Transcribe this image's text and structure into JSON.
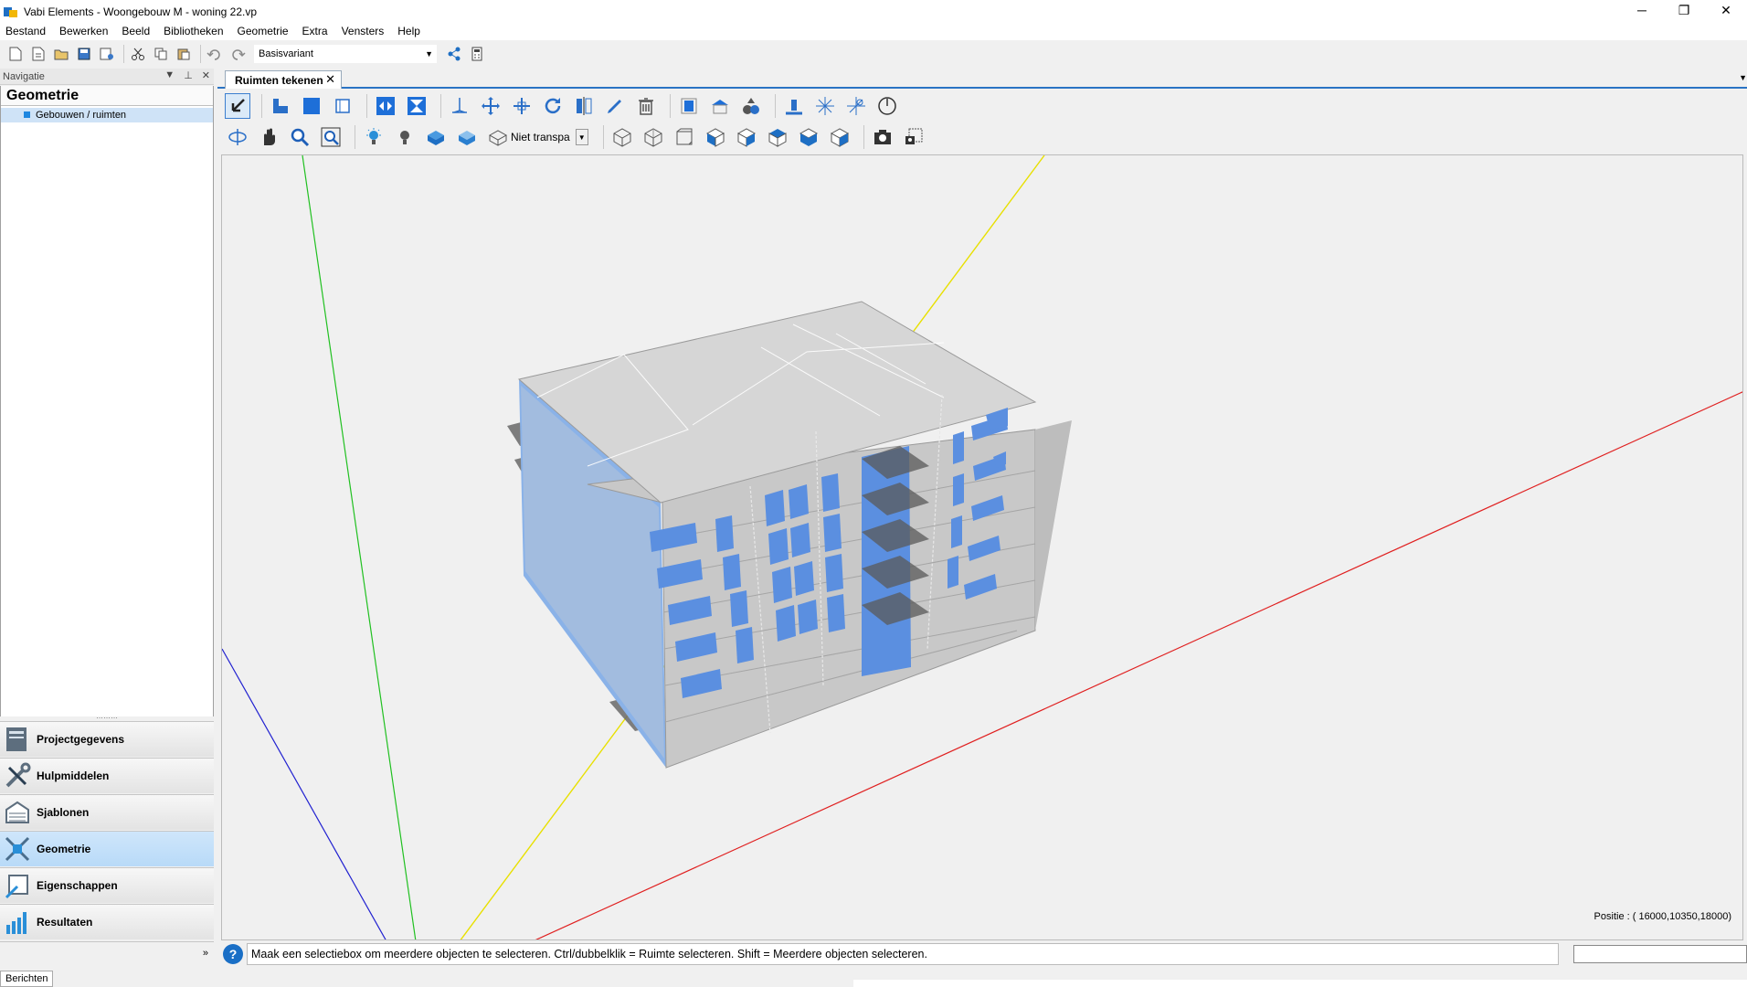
{
  "window": {
    "title": "Vabi Elements - Woongebouw M - woning 22.vp",
    "minimize": "─",
    "restore": "❐",
    "close": "✕"
  },
  "menu": [
    "Bestand",
    "Bewerken",
    "Beeld",
    "Bibliotheken",
    "Geometrie",
    "Extra",
    "Vensters",
    "Help"
  ],
  "toolbar": {
    "variant_value": "Basisvariant",
    "icons": [
      "new-file-icon",
      "new-from-template-icon",
      "open-icon",
      "save-icon",
      "save-as-icon",
      "cut-icon",
      "copy-icon",
      "paste-icon",
      "undo-icon",
      "redo-icon",
      "share-icon",
      "calculator-icon"
    ]
  },
  "navigation": {
    "header": "Navigatie",
    "section_title": "Geometrie",
    "tree_item": "Gebouwen / ruimten",
    "grip": "………",
    "buttons": [
      {
        "label": "Projectgegevens",
        "icon": "project-data-icon"
      },
      {
        "label": "Hulpmiddelen",
        "icon": "tools-icon"
      },
      {
        "label": "Sjablonen",
        "icon": "templates-icon"
      },
      {
        "label": "Geometrie",
        "icon": "geometry-icon",
        "active": true
      },
      {
        "label": "Eigenschappen",
        "icon": "properties-icon"
      },
      {
        "label": "Resultaten",
        "icon": "results-icon"
      }
    ],
    "footer_chevron": "»"
  },
  "document": {
    "tab_label": "Ruimten tekenen",
    "tab_close": "✕",
    "transparency_value": "Niet transpa",
    "position_readout": "Positie : ( 16000,10350,18000)"
  },
  "status": {
    "help": "?",
    "message": "Maak een selectiebox om meerdere objecten te selecteren. Ctrl/dubbelklik = Ruimte selecteren. Shift = Meerdere objecten selecteren."
  },
  "bottom_tab": "Berichten",
  "colors": {
    "accent": "#1e87e0",
    "window_blue": "#5b8fe0",
    "building_grey": "#c8c8c8",
    "axis_x": "#e02020",
    "axis_y": "#20c020",
    "axis_z": "#2020d0",
    "axis_diag": "#e8e000"
  }
}
